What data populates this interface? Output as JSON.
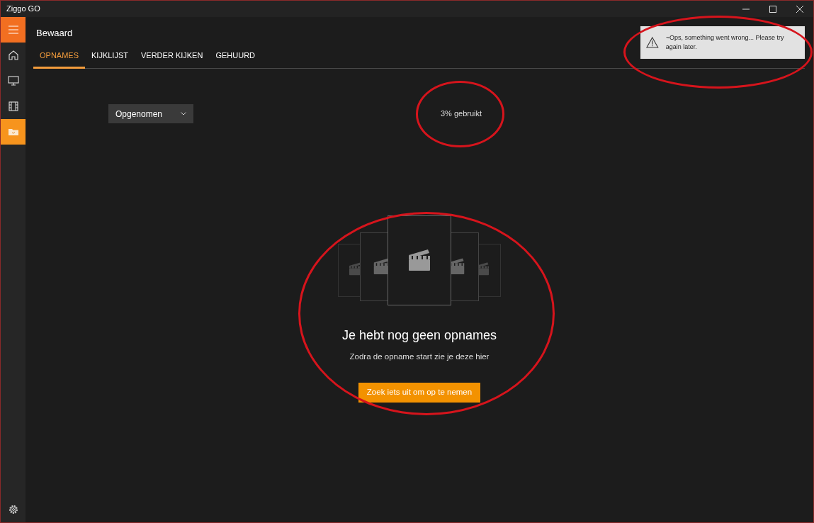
{
  "window": {
    "title": "Ziggo GO",
    "controls": [
      {
        "kind": "minimize"
      },
      {
        "kind": "maximize"
      },
      {
        "kind": "close"
      }
    ]
  },
  "sidebar": {
    "items": [
      {
        "kind": "menu",
        "selected": false
      },
      {
        "kind": "home",
        "selected": false
      },
      {
        "kind": "tv",
        "selected": false
      },
      {
        "kind": "film",
        "selected": false
      },
      {
        "kind": "folder",
        "selected": true
      }
    ],
    "footer": {
      "kind": "settings"
    }
  },
  "page": {
    "title": "Bewaard"
  },
  "tabs": [
    {
      "label": "OPNAMES",
      "selected": true
    },
    {
      "label": "KIJKLIJST",
      "selected": false
    },
    {
      "label": "VERDER KIJKEN",
      "selected": false
    },
    {
      "label": "GEHUURD",
      "selected": false
    }
  ],
  "filter": {
    "value": "Opgenomen"
  },
  "usage": {
    "text": "3% gebruikt",
    "circled": true
  },
  "empty_state": {
    "heading": "Je hebt nog geen opnames",
    "text": "Zodra de opname start zie je deze hier",
    "button": "Zoek iets uit om op te nemen",
    "circled": true
  },
  "toast": {
    "message": "~Ops, something went wrong... Please try again later.",
    "circled": true
  }
}
